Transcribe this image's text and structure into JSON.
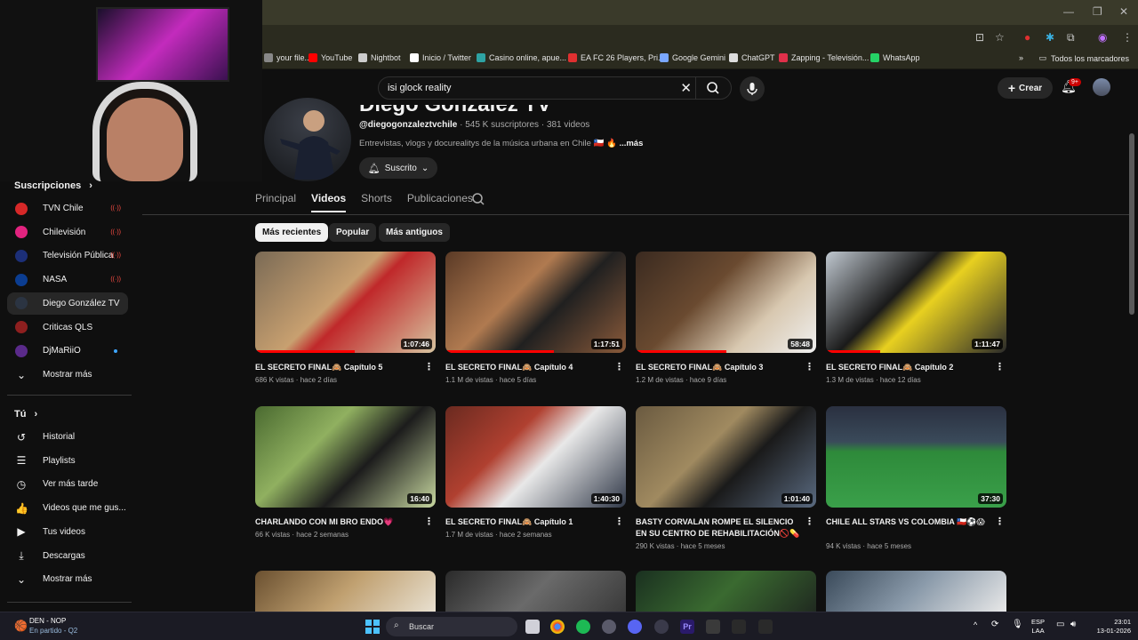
{
  "browser": {
    "bookmarks": [
      {
        "label": "your file...",
        "color": "#888888"
      },
      {
        "label": "YouTube",
        "color": "#ff0000"
      },
      {
        "label": "Nightbot",
        "color": "#cccccc"
      },
      {
        "label": "Inicio / Twitter",
        "color": "#ffffff"
      },
      {
        "label": "Casino online, apue...",
        "color": "#2ea3a3"
      },
      {
        "label": "EA FC 26 Players, Pri...",
        "color": "#e03030"
      },
      {
        "label": "Google Gemini",
        "color": "#7aa7ff"
      },
      {
        "label": "ChatGPT",
        "color": "#dddddd"
      },
      {
        "label": "Zapping - Televisión...",
        "color": "#e0304a"
      },
      {
        "label": "WhatsApp",
        "color": "#25d366"
      }
    ],
    "bookmarks_overflow": "»",
    "all_bookmarks": "Todos los marcadores"
  },
  "youtube": {
    "search_query": "isi glock reality",
    "create_label": "Crear",
    "notif_badge": "9+"
  },
  "channel": {
    "name": "Diego González TV",
    "handle": "@diegogonzaleztvchile",
    "subscribers": "545 K suscriptores",
    "video_count": "381 videos",
    "description": "Entrevistas, vlogs y docurealitys de la música urbana en Chile 🇨🇱 🔥",
    "more": "...más",
    "subscribed_label": "Suscrito"
  },
  "tabs": [
    "Principal",
    "Videos",
    "Shorts",
    "Publicaciones"
  ],
  "chips": [
    "Más recientes",
    "Popular",
    "Más antiguos"
  ],
  "sidebar": {
    "subscriptions_title": "Suscripciones",
    "subscriptions": [
      {
        "label": "TVN Chile",
        "color": "#d62828",
        "live": true
      },
      {
        "label": "Chilevisión",
        "color": "#e2237f",
        "live": true
      },
      {
        "label": "Televisión Pública",
        "color": "#1c2f78",
        "live": true
      },
      {
        "label": "NASA",
        "color": "#0b3d91",
        "live": true
      },
      {
        "label": "Diego González TV",
        "color": "#2b3442",
        "live": false
      },
      {
        "label": "Criticas QLS",
        "color": "#8e1f1f",
        "live": false
      },
      {
        "label": "DjMaRiiO",
        "color": "#5a2a8a",
        "live": false,
        "new": true
      }
    ],
    "show_more": "Mostrar más",
    "you_title": "Tú",
    "you_items": [
      {
        "label": "Historial",
        "icon": "history-icon",
        "glyph": "↺"
      },
      {
        "label": "Playlists",
        "icon": "playlists-icon",
        "glyph": "☰"
      },
      {
        "label": "Ver más tarde",
        "icon": "clock-icon",
        "glyph": "◷"
      },
      {
        "label": "Videos que me gus...",
        "icon": "thumbs-up-icon",
        "glyph": "👍"
      },
      {
        "label": "Tus videos",
        "icon": "play-square-icon",
        "glyph": "▶"
      },
      {
        "label": "Descargas",
        "icon": "download-icon",
        "glyph": "⤓"
      },
      {
        "label": "Mostrar más",
        "icon": "chevron-down-icon",
        "glyph": "⌄"
      }
    ]
  },
  "videos": [
    {
      "title": "EL SECRETO FINAL🙈 Capítulo 5",
      "views": "686 K vistas",
      "age": "hace 2 días",
      "duration": "1:07:46",
      "progress": 0.55,
      "bg": "linear-gradient(135deg,#7a6a55,#c8a070 45%,#c0282a 55%,#d7c4a0)"
    },
    {
      "title": "EL SECRETO FINAL🙈 Capítulo 4",
      "views": "1.1 M de vistas",
      "age": "hace 5 días",
      "duration": "1:17:51",
      "progress": 0.6,
      "bg": "linear-gradient(135deg,#5a3a26,#b07a50 40%,#202020 60%,#8a5a3a)"
    },
    {
      "title": "EL SECRETO FINAL🙈 Capítulo 3",
      "views": "1.2 M de vistas",
      "age": "hace 9 días",
      "duration": "58:48",
      "progress": 0.5,
      "bg": "linear-gradient(135deg,#3a2a20,#6a4a30 40%,#d8c8b0 70%,#f0f0f0)"
    },
    {
      "title": "EL SECRETO FINAL🙈 Capítulo 2",
      "views": "1.3 M de vistas",
      "age": "hace 12 días",
      "duration": "1:11:47",
      "progress": 0.3,
      "bg": "linear-gradient(135deg,#c0c8d0,#1a1a1a 40%,#e8d020 55%,#2a2a2a)"
    },
    {
      "title": "CHARLANDO CON MI BRO ENDO💗",
      "views": "66 K vistas",
      "age": "hace 2 semanas",
      "duration": "16:40",
      "progress": 0,
      "bg": "linear-gradient(135deg,#4a6a30,#90b060 35%,#1c1c1c 60%,#c8d8a0)"
    },
    {
      "title": "EL SECRETO FINAL🙈 Capítulo 1",
      "views": "1.7 M de vistas",
      "age": "hace 2 semanas",
      "duration": "1:40:30",
      "progress": 0,
      "bg": "linear-gradient(135deg,#6a2a20,#b04030 35%,#e8e8e8 55%,#303848)"
    },
    {
      "title": "BASTY CORVALAN ROMPE EL SILENCIO EN SU CENTRO DE REHABILITACIÓN🚫💊",
      "views": "290 K vistas",
      "age": "hace 5 meses",
      "duration": "1:01:40",
      "progress": 0,
      "bg": "linear-gradient(135deg,#6a5a40,#a08a60 40%,#1a1a1a 60%,#5a6a80)"
    },
    {
      "title": "CHILE ALL STARS VS COLOMBIA 🇨🇱⚽😱",
      "views": "94 K vistas",
      "age": "hace 5 meses",
      "duration": "37:30",
      "progress": 0,
      "bg": "linear-gradient(180deg,#2a3040 0%,#3a4a5a 35%,#2e8a3a 45%,#3aa04a 100%)"
    }
  ],
  "row3_bgs": [
    "linear-gradient(135deg,#6a5030,#c0a070 50%,#e8e0d0)",
    "linear-gradient(135deg,#2a2a2a,#6a6a6a 50%,#3a3a3a)",
    "linear-gradient(135deg,#1a3020,#3a6a30 50%,#202a20)",
    "linear-gradient(135deg,#3a4a5a,#8a9aaa 50%,#e8e8e8)"
  ],
  "taskbar": {
    "weather_line1": "DEN - NOP",
    "weather_line2": "En partido - Q2",
    "search_placeholder": "Buscar",
    "lang1": "ESP",
    "lang2": "LAA",
    "time": "23:01",
    "date": "13-01-2026"
  }
}
